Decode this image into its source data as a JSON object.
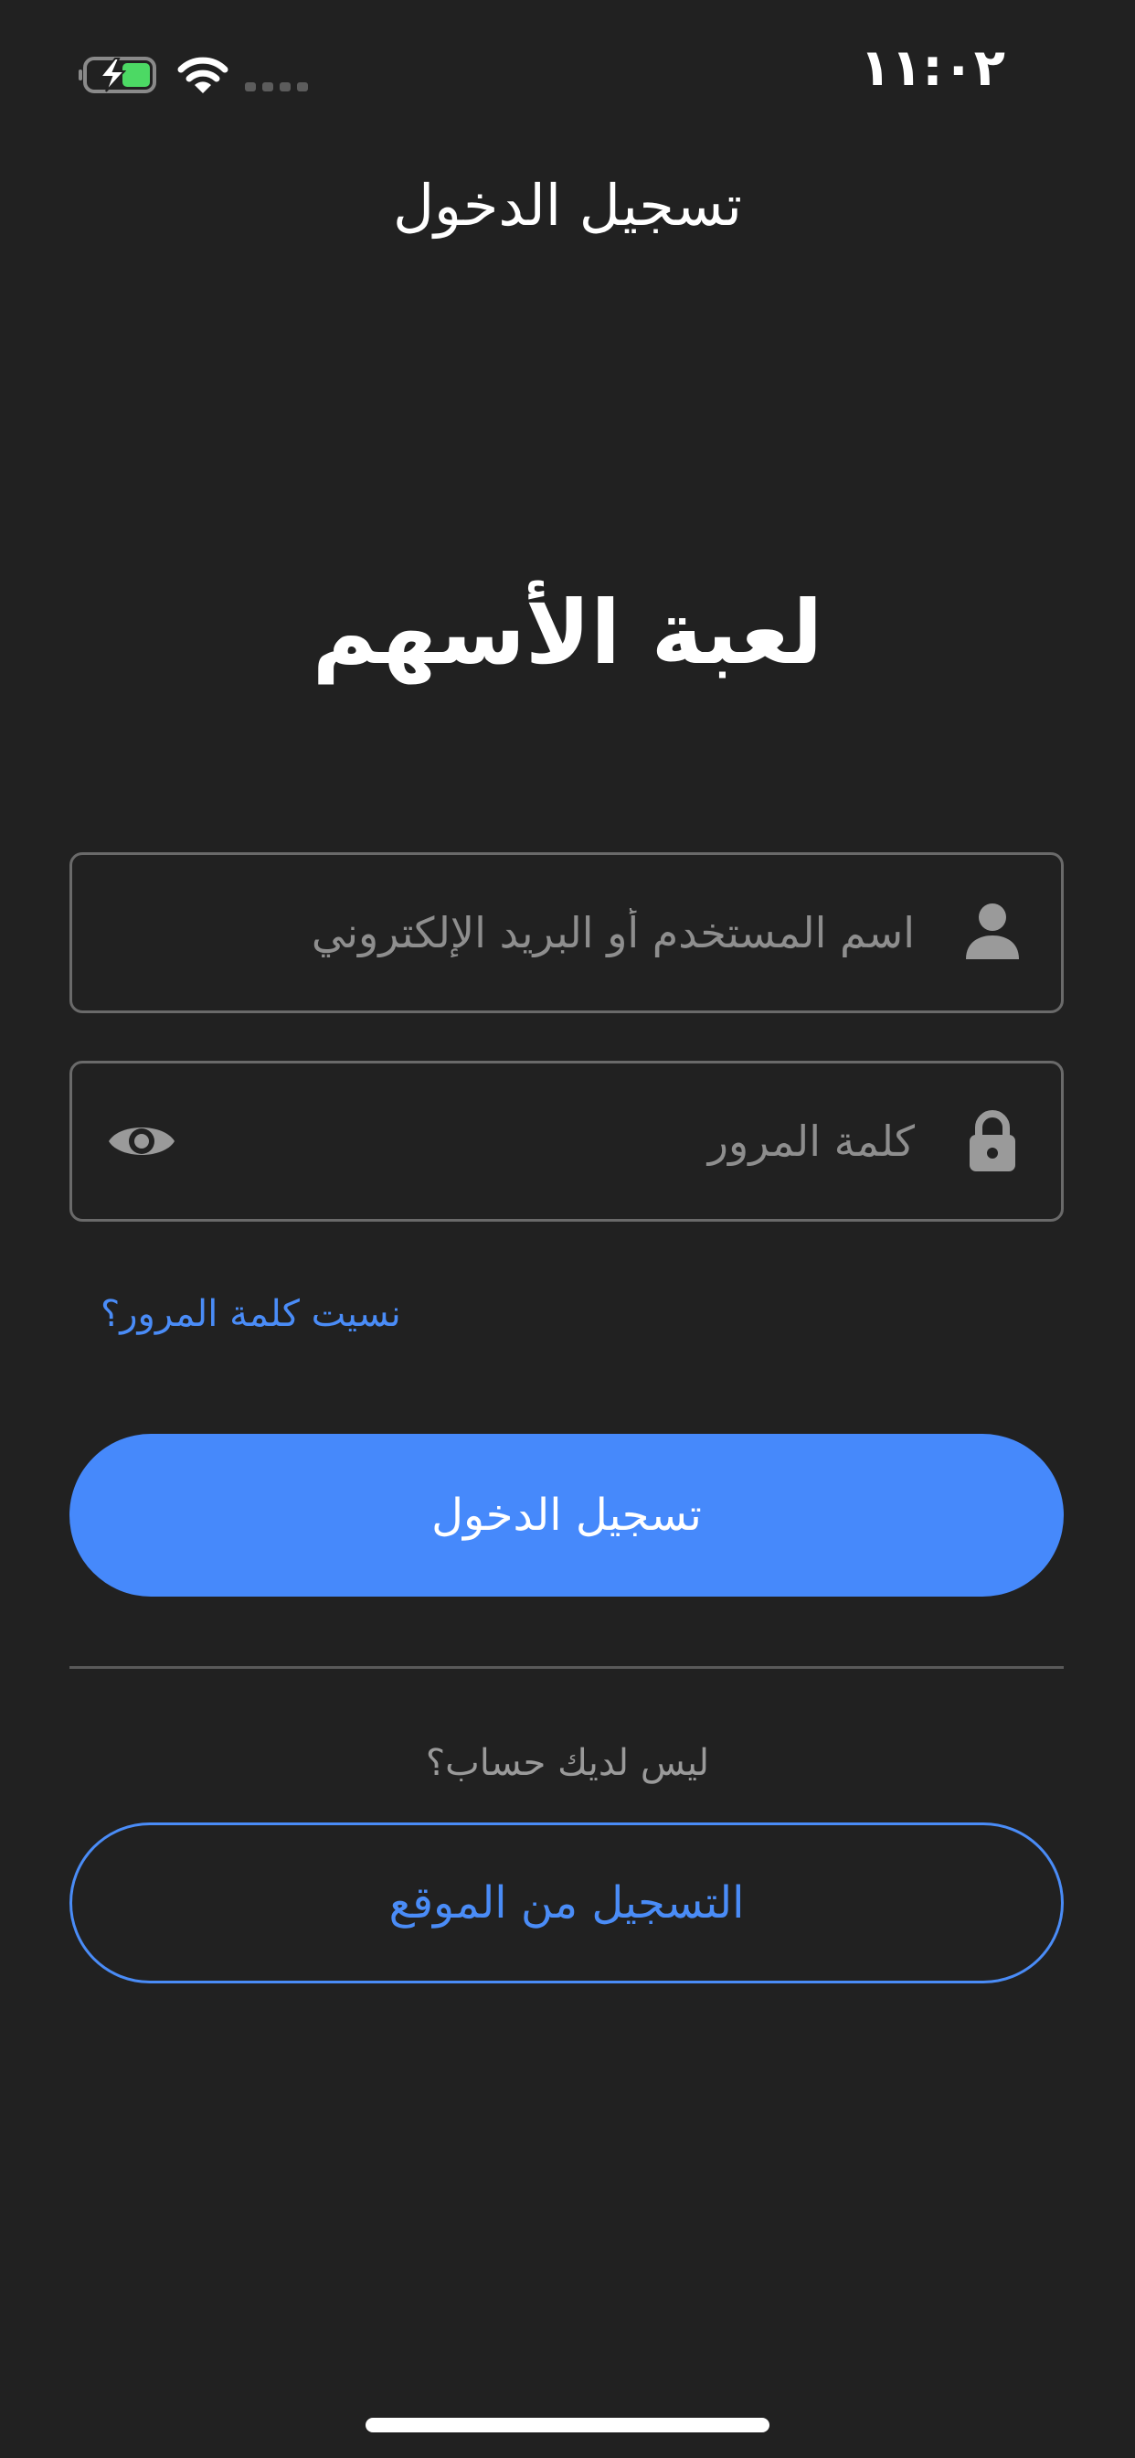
{
  "status_bar": {
    "time": "١١:٠٢",
    "icons": [
      "battery-charging-icon",
      "wifi-icon",
      "cellular-signal-icon"
    ]
  },
  "header": {
    "title": "تسجيل الدخول"
  },
  "app": {
    "name": "لعبة الأسهم"
  },
  "form": {
    "username_placeholder": "اسم المستخدم أو البريد الإلكتروني",
    "username_value": "",
    "password_placeholder": "كلمة المرور",
    "password_value": "",
    "forgot_password": "نسيت كلمة المرور؟",
    "login_button": "تسجيل الدخول"
  },
  "signup": {
    "prompt": "ليس لديك حساب؟",
    "register_button": "التسجيل من الموقع"
  },
  "colors": {
    "background": "#212121",
    "accent": "#4689fb",
    "field_border": "#6a6a6a",
    "battery_fill": "#4cd964"
  }
}
